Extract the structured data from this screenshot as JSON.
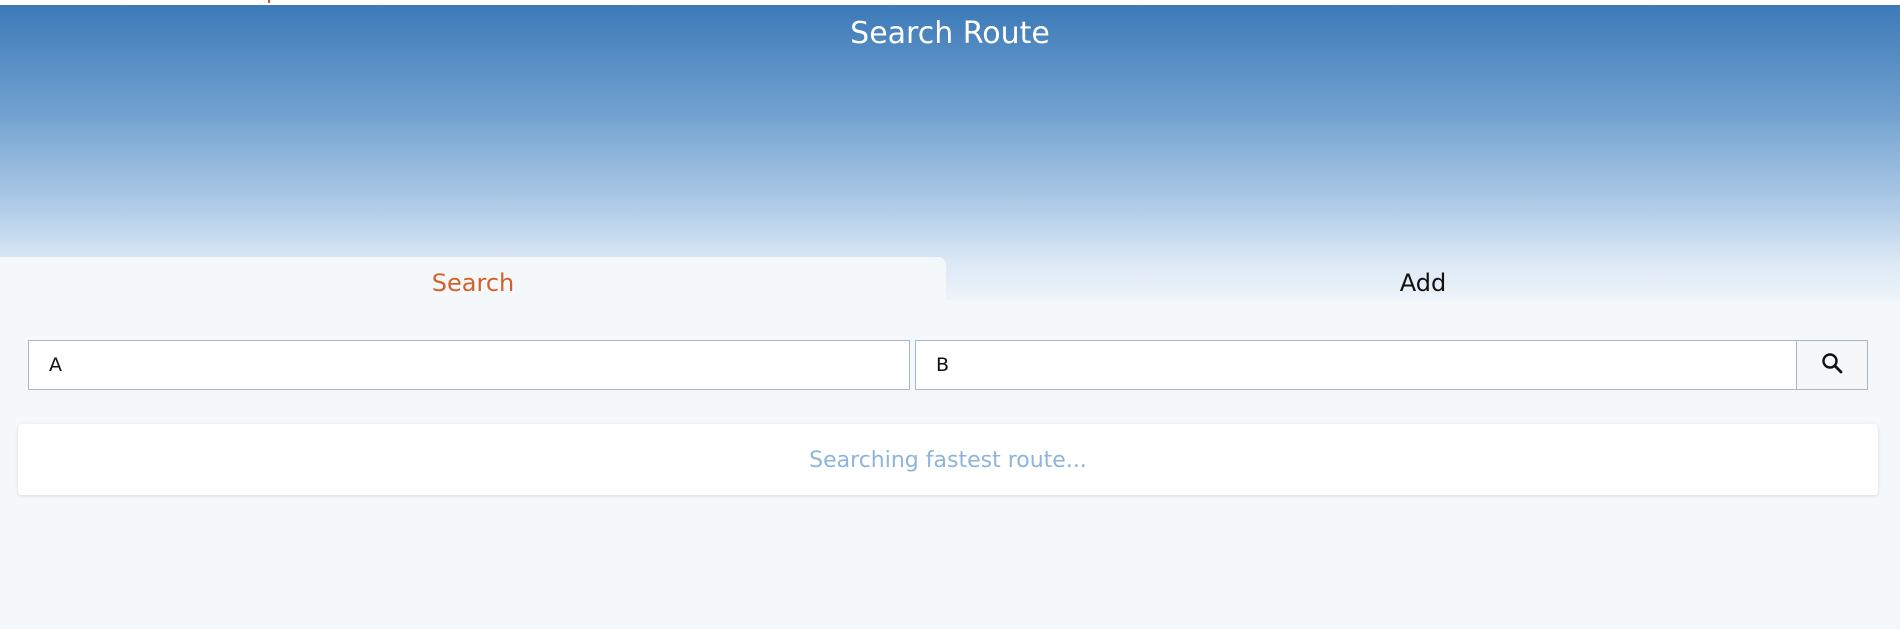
{
  "header": {
    "title": "Search Route"
  },
  "tabs": [
    {
      "label": "Search",
      "active": true
    },
    {
      "label": "Add",
      "active": false
    }
  ],
  "search_form": {
    "from_value": "A",
    "to_value": "B",
    "search_icon": "search-icon"
  },
  "status": {
    "text": "Searching fastest route..."
  },
  "colors": {
    "header_top": "#3c7ab8",
    "header_bottom": "#eef4fa",
    "active_tab": "#d2622a",
    "status_text": "#8db5dc",
    "background": "#f4f8fb"
  }
}
